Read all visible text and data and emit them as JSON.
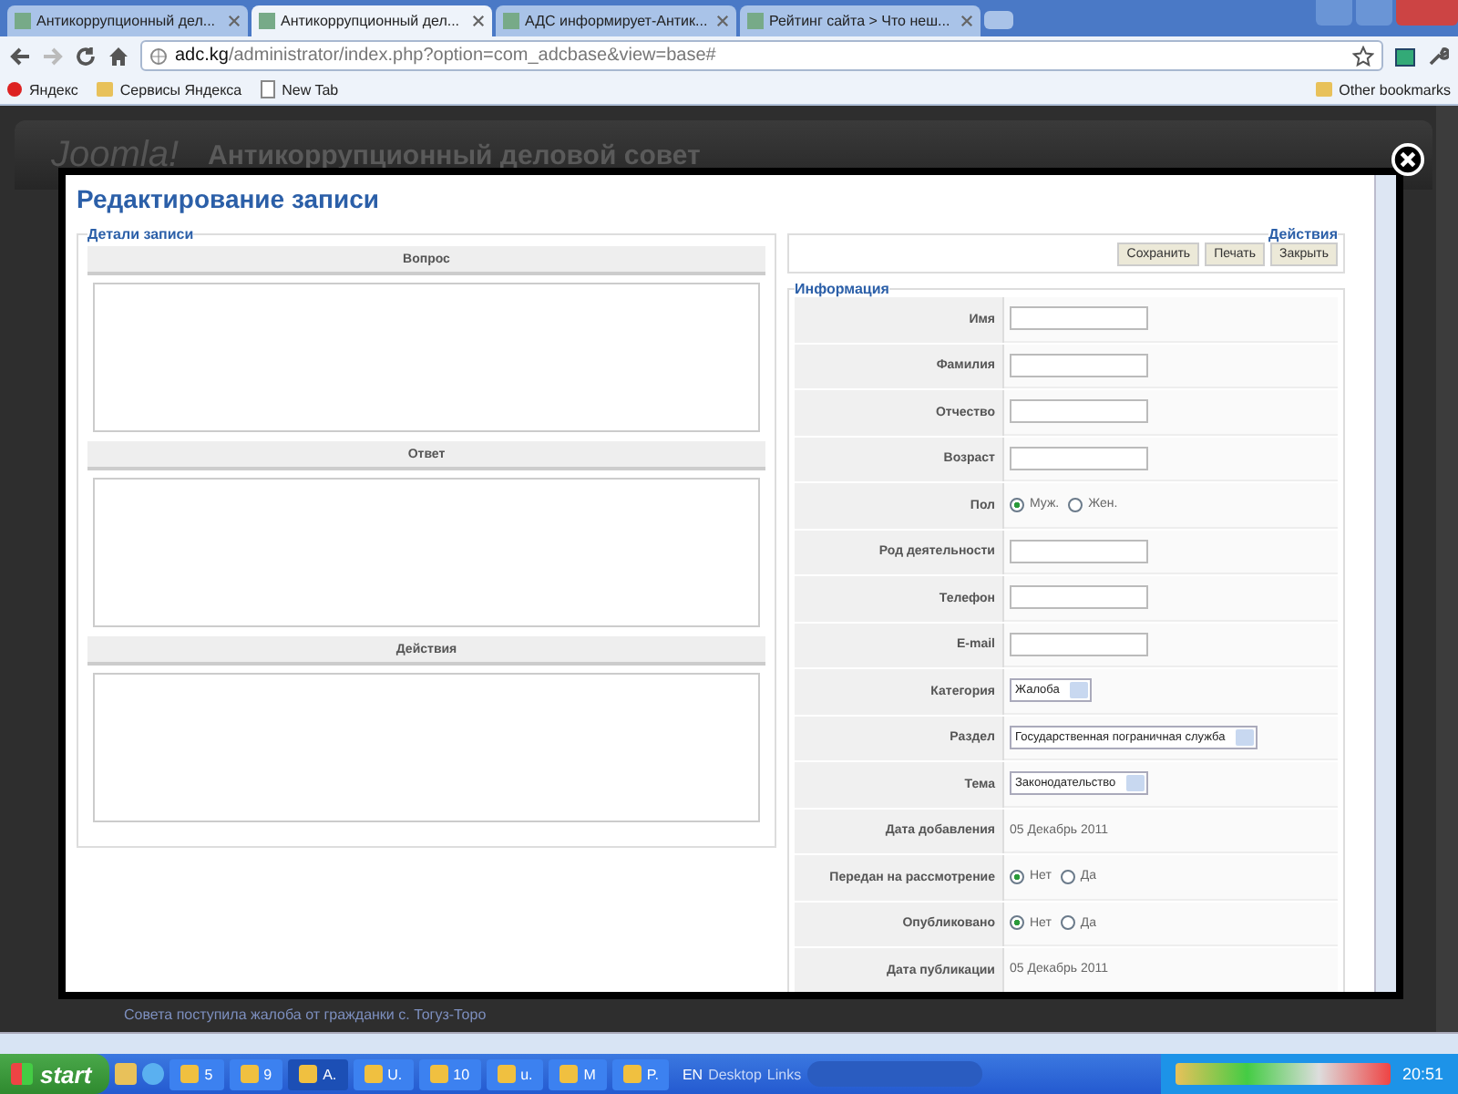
{
  "browser": {
    "tabs": [
      {
        "title": "Антикоррупционный дел...",
        "selected": false
      },
      {
        "title": "Антикоррупционный дел...",
        "selected": true
      },
      {
        "title": "АДС информирует-Антик...",
        "selected": false
      },
      {
        "title": "Рейтинг сайта > Что неш...",
        "selected": false
      }
    ],
    "address": {
      "host": "adc.kg",
      "path": "/administrator/index.php?option=com_adcbase&view=base#"
    },
    "bookmarks": [
      "Яндекс",
      "Сервисы Яндекса",
      "New Tab"
    ],
    "other_bookmarks": "Other bookmarks"
  },
  "site": {
    "logo": "Joomla!",
    "title": "Антикоррупционный деловой совет",
    "background_lines": [
      "Совета поступила жалоба от гражданки с. Тогуз-Торо"
    ]
  },
  "modal": {
    "title": "Редактирование записи",
    "details": {
      "legend": "Детали записи",
      "sections": [
        {
          "heading": "Вопрос"
        },
        {
          "heading": "Ответ"
        },
        {
          "heading": "Действия"
        }
      ]
    },
    "actions": {
      "legend": "Действия",
      "buttons": [
        "Сохранить",
        "Печать",
        "Закрыть"
      ]
    },
    "info": {
      "legend": "Информация",
      "fields": [
        {
          "kind": "text",
          "label": "Имя"
        },
        {
          "kind": "text",
          "label": "Фамилия"
        },
        {
          "kind": "text",
          "label": "Отчество"
        },
        {
          "kind": "text",
          "label": "Возраст"
        },
        {
          "kind": "radio",
          "label": "Пол",
          "options": [
            {
              "label": "Муж.",
              "selected": true
            },
            {
              "label": "Жен.",
              "selected": false
            }
          ]
        },
        {
          "kind": "text",
          "label": "Род деятельности"
        },
        {
          "kind": "text",
          "label": "Телефон"
        },
        {
          "kind": "text",
          "label": "E-mail"
        },
        {
          "kind": "select",
          "label": "Категория",
          "value": "Жалоба"
        },
        {
          "kind": "select",
          "label": "Раздел",
          "value": "Государственная пограничная служба"
        },
        {
          "kind": "select",
          "label": "Тема",
          "value": "Законодательство"
        },
        {
          "kind": "static",
          "label": "Дата добавления",
          "value": "05 Декабрь 2011"
        },
        {
          "kind": "radio",
          "label": "Передан на рассмотрение",
          "options": [
            {
              "label": "Нет",
              "selected": true
            },
            {
              "label": "Да",
              "selected": false
            }
          ]
        },
        {
          "kind": "radio",
          "label": "Опубликовано",
          "options": [
            {
              "label": "Нет",
              "selected": true
            },
            {
              "label": "Да",
              "selected": false
            }
          ]
        },
        {
          "kind": "static",
          "label": "Дата публикации",
          "value": "05 Декабрь 2011"
        }
      ]
    }
  },
  "taskbar": {
    "start": "start",
    "buttons": [
      "5",
      "9",
      "A.",
      "U.",
      "10",
      "u.",
      "M",
      "P."
    ],
    "language": "EN",
    "toolbars": [
      "Desktop",
      "Links"
    ],
    "clock": "20:51"
  }
}
